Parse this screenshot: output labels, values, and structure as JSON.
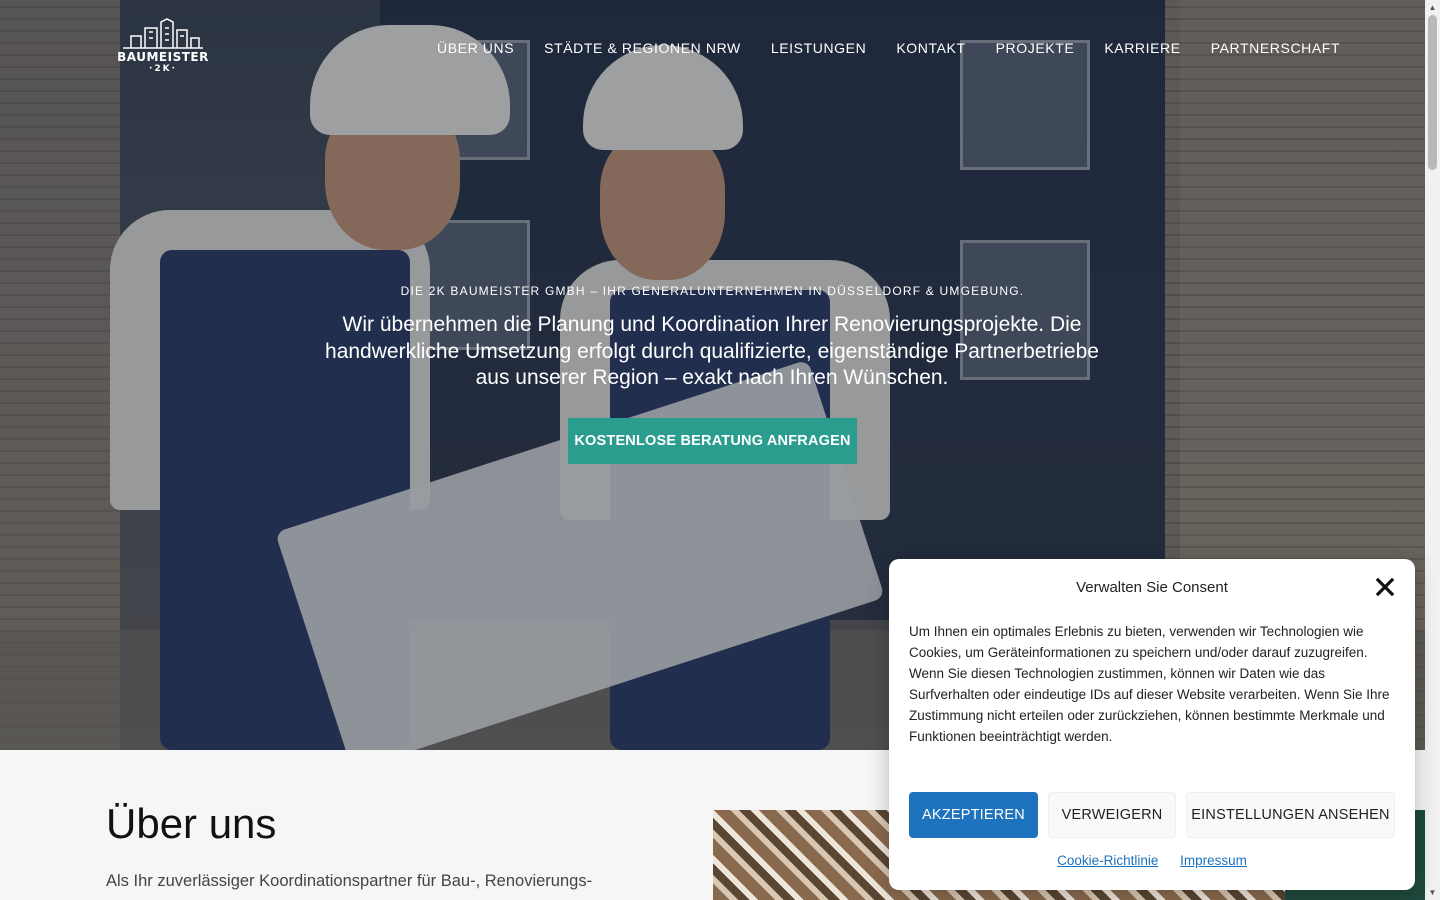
{
  "header": {
    "logo_text": "BAUMEISTER",
    "logo_sub": "·2K·",
    "nav": [
      "ÜBER UNS",
      "STÄDTE & REGIONEN NRW",
      "LEISTUNGEN",
      "KONTAKT",
      "PROJEKTE",
      "KARRIERE",
      "PARTNERSCHAFT"
    ]
  },
  "hero": {
    "tagline": "DIE 2K BAUMEISTER GMBH – IHR GENERALUNTERNEHMEN IN DÜSSELDORF & UMGEBUNG.",
    "headline": "Wir übernehmen die Planung und Koordination Ihrer Renovierungsprojekte. Die handwerkliche Umsetzung erfolgt durch qualifizierte, eigenständige Partnerbetriebe aus unserer Region – exakt nach Ihren Wünschen.",
    "cta": "KOSTENLOSE BERATUNG ANFRAGEN"
  },
  "about": {
    "title": "Über uns",
    "text": "Als Ihr zuverlässiger Koordinationspartner für Bau-, Renovierungs-"
  },
  "consent": {
    "title": "Verwalten Sie Consent",
    "body": "Um Ihnen ein optimales Erlebnis zu bieten, verwenden wir Technologien wie Cookies, um Geräteinformationen zu speichern und/oder darauf zuzugreifen. Wenn Sie diesen Technologien zustimmen, können wir Daten wie das Surfverhalten oder eindeutige IDs auf dieser Website verarbeiten. Wenn Sie Ihre Zustimmung nicht erteilen oder zurückziehen, können bestimmte Merkmale und Funktionen beeinträchtigt werden.",
    "accept": "AKZEPTIEREN",
    "deny": "VERWEIGERN",
    "settings": "EINSTELLUNGEN ANSEHEN",
    "link_cookie": "Cookie-Richtlinie",
    "link_impressum": "Impressum"
  },
  "colors": {
    "cta": "#2a9d8f",
    "accept": "#1e73be",
    "link": "#1e73be"
  }
}
